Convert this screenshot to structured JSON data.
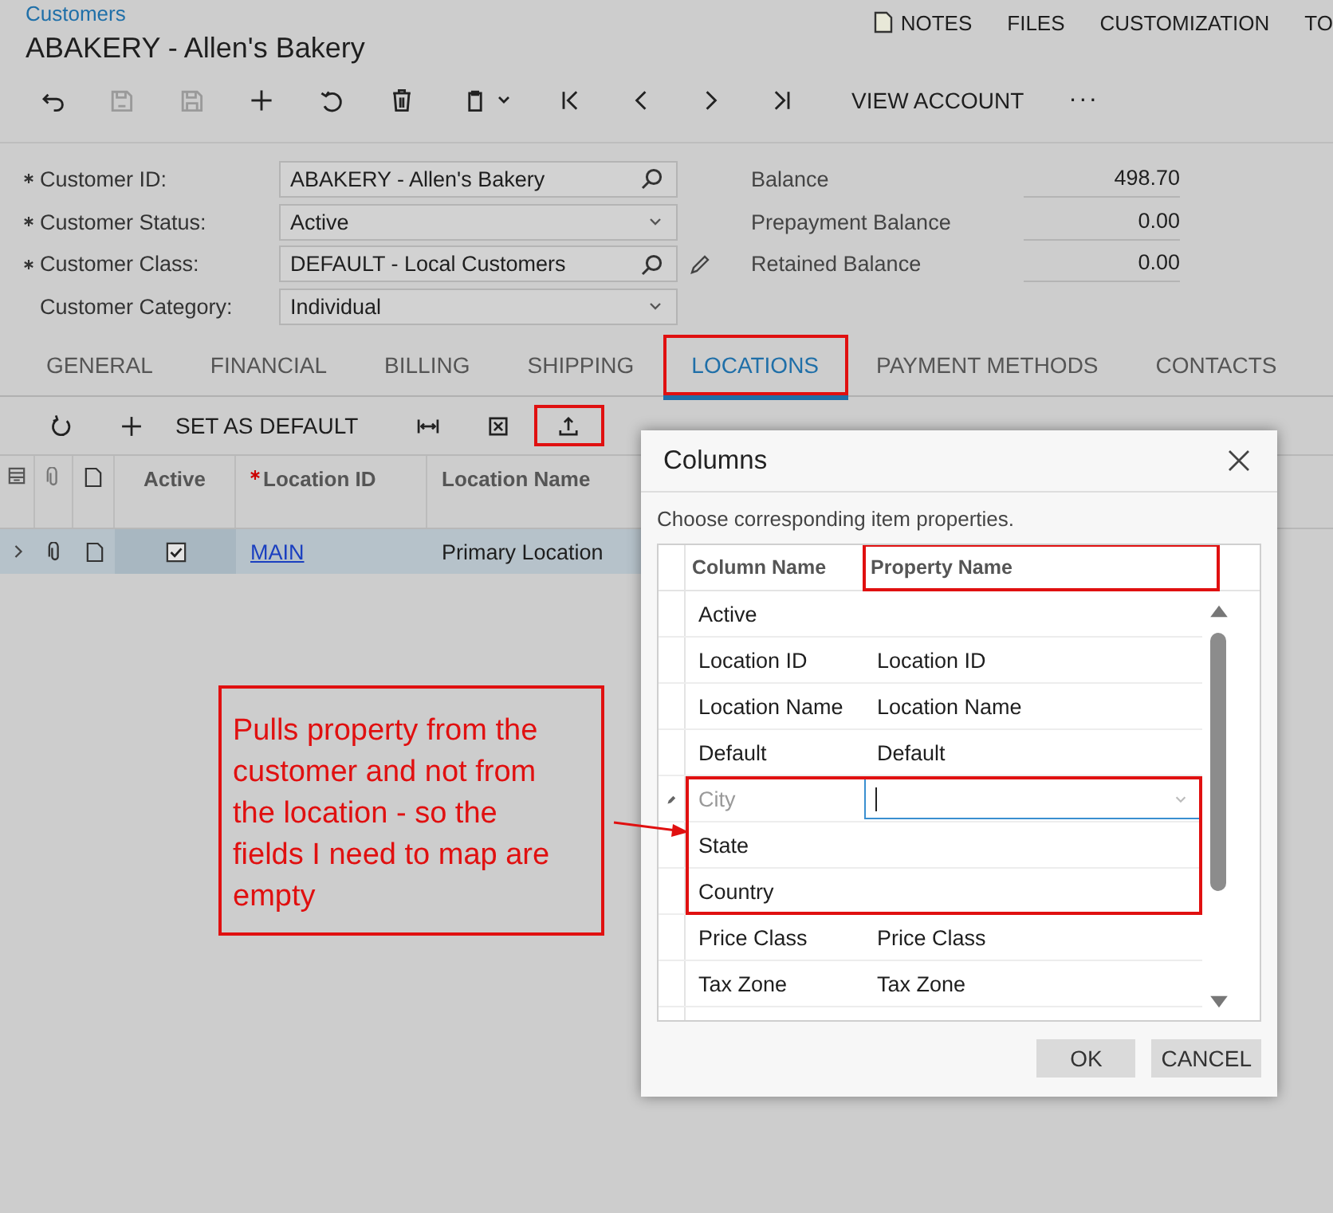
{
  "breadcrumb": "Customers",
  "title": "ABAKERY - Allen's Bakery",
  "header_links": [
    {
      "label": "NOTES",
      "kind": "note"
    },
    {
      "label": "FILES",
      "kind": "plain"
    },
    {
      "label": "CUSTOMIZATION",
      "kind": "plain"
    },
    {
      "label": "TO",
      "kind": "plain"
    }
  ],
  "toolbar": [
    {
      "kind": "icon",
      "disabled": false
    },
    {
      "kind": "icon",
      "disabled": true
    },
    {
      "kind": "icon",
      "disabled": true
    },
    {
      "kind": "icon",
      "disabled": false
    },
    {
      "kind": "icon",
      "disabled": false
    },
    {
      "kind": "icon",
      "disabled": false
    },
    {
      "kind": "icon",
      "disabled": false
    },
    {
      "kind": "icon",
      "disabled": false
    },
    {
      "kind": "icon",
      "disabled": false
    },
    {
      "kind": "icon",
      "disabled": false
    },
    {
      "kind": "icon",
      "disabled": false
    },
    {
      "kind": "text",
      "label": "VIEW ACCOUNT"
    },
    {
      "kind": "text",
      "label": "···"
    }
  ],
  "fields": [
    {
      "label": "Customer ID:",
      "required": true,
      "value": "ABAKERY - Allen's Bakery",
      "kind": "lookup",
      "edit_button": false
    },
    {
      "label": "Customer Status:",
      "required": true,
      "value": "Active",
      "kind": "select",
      "edit_button": false
    },
    {
      "label": "Customer Class:",
      "required": true,
      "value": "DEFAULT - Local Customers",
      "kind": "lookup",
      "edit_button": true
    },
    {
      "label": "Customer Category:",
      "required": false,
      "value": "Individual",
      "kind": "select",
      "edit_button": false
    }
  ],
  "balances": [
    {
      "label": "Balance",
      "value": "498.70"
    },
    {
      "label": "Prepayment Balance",
      "value": "0.00"
    },
    {
      "label": "Retained Balance",
      "value": "0.00"
    }
  ],
  "tabs": [
    {
      "label": "GENERAL",
      "selected": false,
      "highlighted": false
    },
    {
      "label": "FINANCIAL",
      "selected": false,
      "highlighted": false
    },
    {
      "label": "BILLING",
      "selected": false,
      "highlighted": false
    },
    {
      "label": "SHIPPING",
      "selected": false,
      "highlighted": false
    },
    {
      "label": "LOCATIONS",
      "selected": true,
      "highlighted": true
    },
    {
      "label": "PAYMENT METHODS",
      "selected": false,
      "highlighted": false
    },
    {
      "label": "CONTACTS",
      "selected": false,
      "highlighted": false
    }
  ],
  "grid_toolbar": [
    {
      "kind": "icon",
      "highlighted": false
    },
    {
      "kind": "icon",
      "highlighted": false
    },
    {
      "kind": "text",
      "label": "SET AS DEFAULT",
      "highlighted": false
    },
    {
      "kind": "icon",
      "highlighted": false
    },
    {
      "kind": "icon",
      "highlighted": false
    },
    {
      "kind": "icon",
      "highlighted": true
    }
  ],
  "grid": {
    "columns": [
      {
        "label": "Active",
        "required": false
      },
      {
        "label": "Location ID",
        "required": true
      },
      {
        "label": "Location Name",
        "required": false
      }
    ],
    "rows": [
      {
        "active": true,
        "location_id": "MAIN",
        "location_name": "Primary Location",
        "selected": true
      }
    ]
  },
  "dialog": {
    "title": "Columns",
    "instruction": "Choose corresponding item properties.",
    "columns": [
      {
        "label": "Column Name",
        "highlighted": false
      },
      {
        "label": "Property Name",
        "highlighted": true
      }
    ],
    "rows": [
      {
        "column": "Active",
        "editing": false,
        "highlighted": false
      },
      {
        "column": "Location ID",
        "property": "Location ID",
        "editing": false,
        "highlighted": false
      },
      {
        "column": "Location Name",
        "property": "Location Name",
        "editing": false,
        "highlighted": false
      },
      {
        "column": "Default",
        "property": "Default",
        "editing": false,
        "highlighted": false
      },
      {
        "column": "City",
        "editing": true,
        "highlighted": true
      },
      {
        "column": "State",
        "editing": false,
        "highlighted": true
      },
      {
        "column": "Country",
        "editing": false,
        "highlighted": true
      },
      {
        "column": "Price Class",
        "property": "Price Class",
        "editing": false,
        "highlighted": false
      },
      {
        "column": "Tax Zone",
        "property": "Tax Zone",
        "editing": false,
        "highlighted": false
      }
    ],
    "buttons": [
      "OK",
      "CANCEL"
    ]
  },
  "annotation": {
    "text": "Pulls property from the customer and not from the location - so the fields I need to map are empty"
  }
}
